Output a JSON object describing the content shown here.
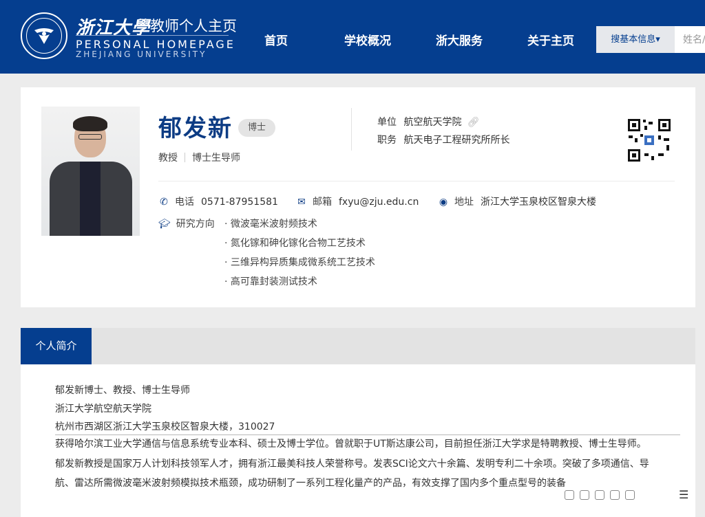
{
  "header": {
    "university_cn": "浙江大學",
    "site_title": "教师个人主页",
    "site_title_en": "PERSONAL HOMEPAGE",
    "university_en": "ZHEJIANG UNIVERSITY",
    "seal_text": "ZHEJIANG UNIVERSITY",
    "nav": [
      "首页",
      "学校概况",
      "浙大服务",
      "关于主页"
    ],
    "search_select": "搜基本信息",
    "search_placeholder": "姓名/"
  },
  "profile": {
    "name": "郁发新",
    "degree_badge": "博士",
    "title": "教授",
    "supervisor": "博士生导师",
    "unit_label": "单位",
    "unit": "航空航天学院",
    "duty_label": "职务",
    "duty": "航天电子工程研究所所长",
    "phone_label": "电话",
    "phone": "0571-87951581",
    "email_label": "邮箱",
    "email": "fxyu@zju.edu.cn",
    "address_label": "地址",
    "address": "浙江大学玉泉校区智泉大楼",
    "research_label": "研究方向",
    "research": [
      "· 微波毫米波射频技术",
      "· 氮化镓和砷化镓化合物工艺技术",
      "· 三维异构异质集成微系统工艺技术",
      "· 高可靠封装测试技术"
    ]
  },
  "intro": {
    "tab": "个人简介",
    "lines": [
      "郁发新博士、教授、博士生导师",
      "浙江大学航空航天学院",
      "杭州市西湖区浙江大学玉泉校区智泉大楼，310027"
    ],
    "paragraph": [
      "获得哈尔滨工业大学通信与信息系统专业本科、硕士及博士学位。曾就职于UT斯达康公司，目前担任浙江大学求是特聘教授、博士生导师。",
      "郁发新教授是国家万人计划科技领军人才，拥有浙江最美科技人荣誉称号。发表SCI论文六十余篇、发明专利二十余项。突破了多项通信、导",
      "航、雷达所需微波毫米波射频模拟技术瓶颈，成功研制了一系列工程化量产的产品，有效支撑了国内多个重点型号的装备"
    ]
  },
  "colors": {
    "brand": "#053e8f",
    "name": "#0d3c84",
    "page_bg": "#ececec"
  }
}
